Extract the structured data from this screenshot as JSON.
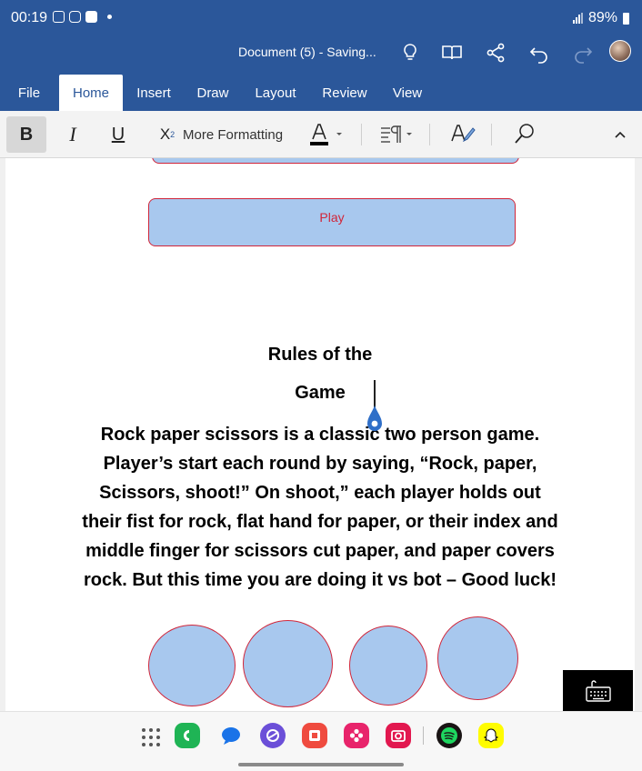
{
  "status_bar": {
    "time": "00:19",
    "battery": "89%"
  },
  "document": {
    "title": "Document (5) - Saving..."
  },
  "tabs": [
    {
      "label": "File"
    },
    {
      "label": "Home"
    },
    {
      "label": "Insert"
    },
    {
      "label": "Draw"
    },
    {
      "label": "Layout"
    },
    {
      "label": "Review"
    },
    {
      "label": "View"
    }
  ],
  "active_tab": "Home",
  "ribbon": {
    "bold": "B",
    "italic": "I",
    "underline": "U",
    "subscript_base": "X",
    "subscript_sub": "2",
    "more_formatting": "More Formatting"
  },
  "content": {
    "play_label": "Play",
    "heading_line1": "Rules of the",
    "heading_line2": "Game",
    "paragraph": "Rock paper scissors is a classic two person game. Player’s start each round by saying, “Rock, paper, Scissors,  shoot!” On shoot,” each player holds out their fist for rock, flat hand for paper, or their index and middle finger for scissors cut paper, and paper covers rock. But this time you are doing it vs bot – Good luck!"
  },
  "colors": {
    "office_blue": "#2b579a",
    "shape_fill": "#a8c8ee",
    "shape_border": "#d1263a"
  },
  "dock": {
    "apps": [
      "phone-app",
      "messages-app",
      "browser-app",
      "gallery-app",
      "flower-app",
      "camera-app",
      "spotify-app",
      "snapchat-app"
    ]
  }
}
